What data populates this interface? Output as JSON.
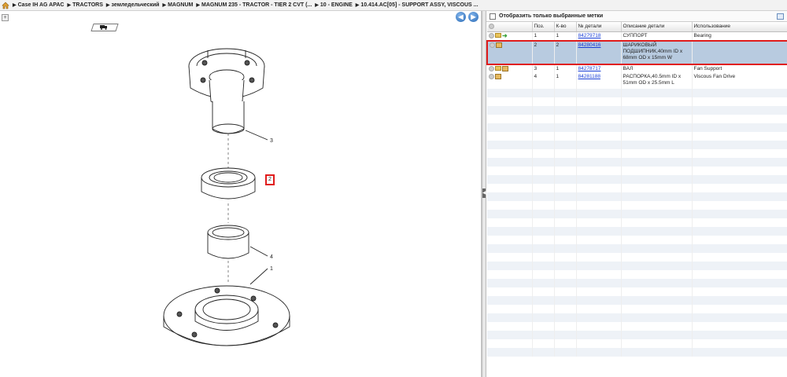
{
  "breadcrumb": [
    "Case IH AG APAC",
    "TRACTORS",
    "земледельческий",
    "MAGNUM",
    "MAGNUM 235 - TRACTOR - TIER 2 CVT (...",
    "10 - ENGINE",
    "10.414.AC[05] - SUPPORT ASSY, VISCOUS ..."
  ],
  "drawing": {
    "callouts": [
      "3",
      "2",
      "4",
      "1"
    ]
  },
  "filter": {
    "label": "Отобразить только выбранные метки"
  },
  "table": {
    "headers": [
      "",
      "Поз.",
      "К-во",
      "№ детали",
      "Описание детали",
      "Использование"
    ],
    "rows": [
      {
        "pos": "1",
        "qty": "1",
        "part": "84279718",
        "desc": "СУППОРТ",
        "usage": "Bearing"
      },
      {
        "pos": "2",
        "qty": "2",
        "part": "84280416",
        "desc": "ШАРИКОВЫЙ ПОДШИПНИК,40mm ID x 68mm OD x 15mm W",
        "usage": ""
      },
      {
        "pos": "3",
        "qty": "1",
        "part": "84278717",
        "desc": "ВАЛ",
        "usage": "Fan Support"
      },
      {
        "pos": "4",
        "qty": "1",
        "part": "84281188",
        "desc": "РАСПОРКА,40.5mm ID x 51mm OD x 25.5mm L",
        "usage": "Viscous Fan Drive"
      }
    ]
  },
  "colors": {
    "selection_border": "#e01b1b",
    "selected_row": "#b8cbe0",
    "link": "#1a3fd6"
  }
}
